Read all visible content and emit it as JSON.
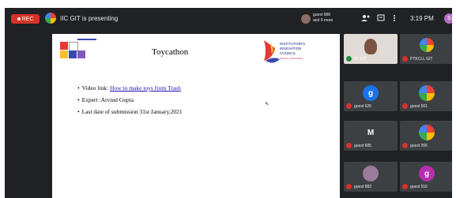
{
  "topbar": {
    "rec_label": "REC",
    "presenting_text": "IIC GIT is presenting",
    "guest_join_line1": "guest 688",
    "guest_join_line2": "and 9 more",
    "time": "3:19 PM",
    "account_initial": "S",
    "icons": [
      "participants-icon",
      "chat-icon",
      "more-icon"
    ]
  },
  "slide": {
    "title": "Toycathon",
    "right_logo_lines": [
      "INSTITUTION'S",
      "INNOVATION",
      "COUNCIL",
      "(Ministry of Education)"
    ],
    "bullets": [
      {
        "prefix": "Video link: ",
        "link": "How to make toys from Trash"
      },
      {
        "prefix": "Expert :Arvind Gupta",
        "link": ""
      },
      {
        "prefix": "Last date of submission 31st January,2021",
        "link": ""
      }
    ]
  },
  "participants": [
    {
      "name": "IIC GIT",
      "type": "video",
      "color": "#e0dbd6"
    },
    {
      "name": "PTKCLL GIT",
      "type": "logo",
      "color": "#3c4043"
    },
    {
      "name": "guest 626",
      "type": "avatar",
      "initial": "g",
      "color": "#1a73e8"
    },
    {
      "name": "guest 561",
      "type": "logo",
      "color": "#3c4043"
    },
    {
      "name": "guest 685",
      "type": "avatar",
      "initial": "M",
      "color": "#3c4043"
    },
    {
      "name": "guest 306",
      "type": "logo",
      "color": "#3c4043"
    },
    {
      "name": "guest 882",
      "type": "avatar",
      "initial": "",
      "color": "#9a7b9a"
    },
    {
      "name": "guest 516",
      "type": "avatar",
      "initial": "g",
      "color": "#b52fae"
    }
  ]
}
